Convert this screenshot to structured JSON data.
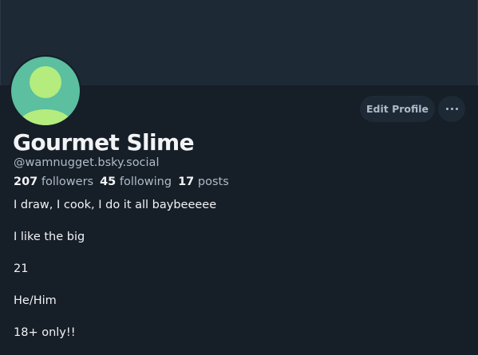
{
  "profile": {
    "display_name": "Gourmet Slime",
    "handle": "@wamnugget.bsky.social",
    "avatar_icon": "default-user-avatar-icon",
    "avatar_bg_color": "#5bbfa0",
    "avatar_fg_color": "#b4ec7e"
  },
  "stats": {
    "followers_count": "207",
    "followers_label": "followers",
    "following_count": "45",
    "following_label": "following",
    "posts_count": "17",
    "posts_label": "posts"
  },
  "actions": {
    "edit_profile_label": "Edit Profile",
    "more_icon": "ellipsis-icon"
  },
  "bio": {
    "lines": [
      "I draw, I cook, I do it all baybeeeee",
      "I like the big",
      "21",
      "He/Him",
      "18+ only!!"
    ]
  }
}
